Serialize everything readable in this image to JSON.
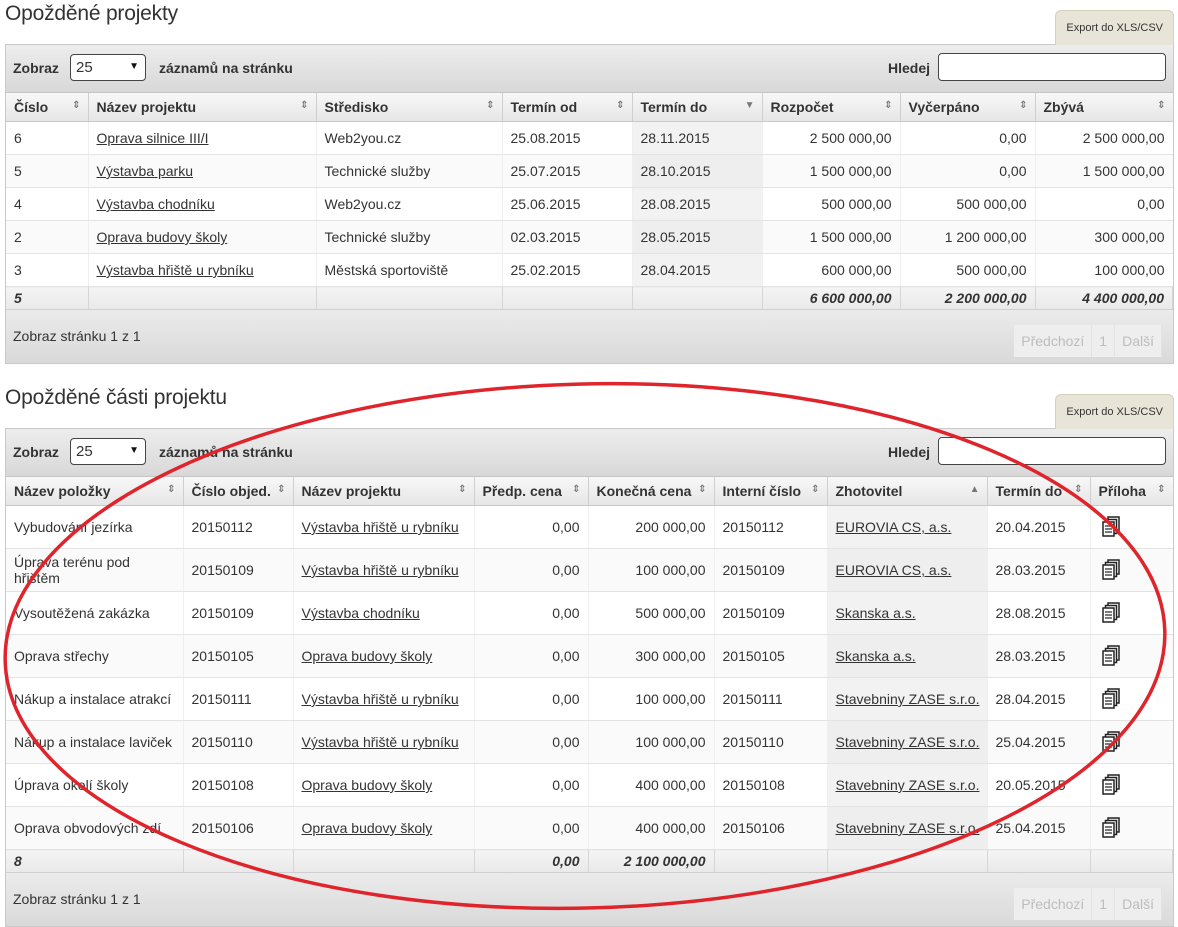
{
  "section1": {
    "title": "Opožděné projekty",
    "export_label": "Export do XLS/CSV",
    "toolbar": {
      "zobraz": "Zobraz",
      "page_size": "25",
      "per_page": "záznamů na stránku",
      "search_label": "Hledej",
      "search_value": ""
    },
    "columns": [
      "Číslo",
      "Název projektu",
      "Středisko",
      "Termín od",
      "Termín do",
      "Rozpočet",
      "Vyčerpáno",
      "Zbývá"
    ],
    "rows": [
      {
        "cislo": "6",
        "nazev": "Oprava silnice III/I",
        "stredisko": "Web2you.cz",
        "od": "25.08.2015",
        "do": "28.11.2015",
        "rozpocet": "2 500 000,00",
        "vycerpano": "0,00",
        "zbyva": "2 500 000,00"
      },
      {
        "cislo": "5",
        "nazev": "Výstavba parku",
        "stredisko": "Technické služby",
        "od": "25.07.2015",
        "do": "28.10.2015",
        "rozpocet": "1 500 000,00",
        "vycerpano": "0,00",
        "zbyva": "1 500 000,00"
      },
      {
        "cislo": "4",
        "nazev": "Výstavba chodníku",
        "stredisko": "Web2you.cz",
        "od": "25.06.2015",
        "do": "28.08.2015",
        "rozpocet": "500 000,00",
        "vycerpano": "500 000,00",
        "zbyva": "0,00"
      },
      {
        "cislo": "2",
        "nazev": "Oprava budovy školy",
        "stredisko": "Technické služby",
        "od": "02.03.2015",
        "do": "28.05.2015",
        "rozpocet": "1 500 000,00",
        "vycerpano": "1 200 000,00",
        "zbyva": "300 000,00"
      },
      {
        "cislo": "3",
        "nazev": "Výstavba hřiště u rybníku",
        "stredisko": "Městská sportoviště",
        "od": "25.02.2015",
        "do": "28.04.2015",
        "rozpocet": "600 000,00",
        "vycerpano": "500 000,00",
        "zbyva": "100 000,00"
      }
    ],
    "footer": {
      "count": "5",
      "rozpocet": "6 600 000,00",
      "vycerpano": "2 200 000,00",
      "zbyva": "4 400 000,00"
    },
    "pager": {
      "info": "Zobraz stránku 1 z 1",
      "prev": "Předchozí",
      "page": "1",
      "next": "Další"
    }
  },
  "section2": {
    "title": "Opožděné části projektu",
    "export_label": "Export do XLS/CSV",
    "toolbar": {
      "zobraz": "Zobraz",
      "page_size": "25",
      "per_page": "záznamů na stránku",
      "search_label": "Hledej",
      "search_value": ""
    },
    "columns": [
      "Název položky",
      "Číslo objed.",
      "Název projektu",
      "Předp. cena",
      "Konečná cena",
      "Interní číslo",
      "Zhotovitel",
      "Termín do",
      "Příloha"
    ],
    "rows": [
      {
        "polozka": "Vybudování jezírka",
        "objed": "20150112",
        "projekt": "Výstavba hřiště u rybníku",
        "predp": "0,00",
        "konecna": "200 000,00",
        "interni": "20150112",
        "zhotovitel": "EUROVIA CS, a.s.",
        "termin": "20.04.2015"
      },
      {
        "polozka": "Úprava terénu pod hřištěm",
        "objed": "20150109",
        "projekt": "Výstavba hřiště u rybníku",
        "predp": "0,00",
        "konecna": "100 000,00",
        "interni": "20150109",
        "zhotovitel": "EUROVIA CS, a.s.",
        "termin": "28.03.2015"
      },
      {
        "polozka": "Vysoutěžená zakázka",
        "objed": "20150109",
        "projekt": "Výstavba chodníku",
        "predp": "0,00",
        "konecna": "500 000,00",
        "interni": "20150109",
        "zhotovitel": "Skanska a.s.",
        "termin": "28.08.2015"
      },
      {
        "polozka": "Oprava střechy",
        "objed": "20150105",
        "projekt": "Oprava budovy školy",
        "predp": "0,00",
        "konecna": "300 000,00",
        "interni": "20150105",
        "zhotovitel": "Skanska a.s.",
        "termin": "28.03.2015"
      },
      {
        "polozka": "Nákup a instalace atrakcí",
        "objed": "20150111",
        "projekt": "Výstavba hřiště u rybníku",
        "predp": "0,00",
        "konecna": "100 000,00",
        "interni": "20150111",
        "zhotovitel": "Stavebniny ZASE s.r.o.",
        "termin": "28.04.2015"
      },
      {
        "polozka": "Nákup a instalace laviček",
        "objed": "20150110",
        "projekt": "Výstavba hřiště u rybníku",
        "predp": "0,00",
        "konecna": "100 000,00",
        "interni": "20150110",
        "zhotovitel": "Stavebniny ZASE s.r.o.",
        "termin": "25.04.2015"
      },
      {
        "polozka": "Úprava okolí školy",
        "objed": "20150108",
        "projekt": "Oprava budovy školy",
        "predp": "0,00",
        "konecna": "400 000,00",
        "interni": "20150108",
        "zhotovitel": "Stavebniny ZASE s.r.o.",
        "termin": "20.05.2015"
      },
      {
        "polozka": "Oprava obvodových zdí",
        "objed": "20150106",
        "projekt": "Oprava budovy školy",
        "predp": "0,00",
        "konecna": "400 000,00",
        "interni": "20150106",
        "zhotovitel": "Stavebniny ZASE s.r.o.",
        "termin": "25.04.2015"
      }
    ],
    "footer": {
      "count": "8",
      "predp": "0,00",
      "konecna": "2 100 000,00"
    },
    "pager": {
      "info": "Zobraz stránku 1 z 1",
      "prev": "Předchozí",
      "page": "1",
      "next": "Další"
    }
  },
  "icons": {
    "attachment": "document-copy-icon",
    "sort": "sort-icon",
    "dropdown": "chevron-down-icon"
  },
  "colors": {
    "annotation": "#e0242b",
    "export_tab": "#e9e4d8"
  }
}
